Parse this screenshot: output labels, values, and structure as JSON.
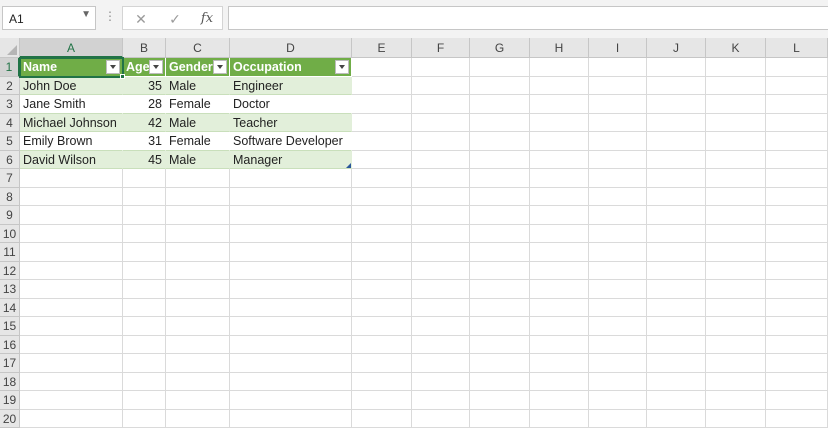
{
  "formula_bar": {
    "name_box": "A1",
    "name_box_arrow": "▼",
    "dots": "⋮",
    "cancel_glyph": "✕",
    "enter_glyph": "✓",
    "fx_glyph": "fx",
    "formula_value": ""
  },
  "columns": [
    "A",
    "B",
    "C",
    "D",
    "E",
    "F",
    "G",
    "H",
    "I",
    "J",
    "K",
    "L"
  ],
  "rows": [
    "1",
    "2",
    "3",
    "4",
    "5",
    "6",
    "7",
    "8",
    "9",
    "10",
    "11",
    "12",
    "13",
    "14",
    "15",
    "16",
    "17",
    "18",
    "19",
    "20"
  ],
  "table": {
    "headers": [
      "Name",
      "Age",
      "Gender",
      "Occupation"
    ],
    "data": [
      [
        "John Doe",
        "35",
        "Male",
        "Engineer"
      ],
      [
        "Jane Smith",
        "28",
        "Female",
        "Doctor"
      ],
      [
        "Michael Johnson",
        "42",
        "Male",
        "Teacher"
      ],
      [
        "Emily Brown",
        "31",
        "Female",
        "Software Developer"
      ],
      [
        "David Wilson",
        "45",
        "Male",
        "Manager"
      ]
    ]
  },
  "colors": {
    "table_header": "#70ad47",
    "table_band": "#e2efda",
    "selection": "#217346"
  }
}
